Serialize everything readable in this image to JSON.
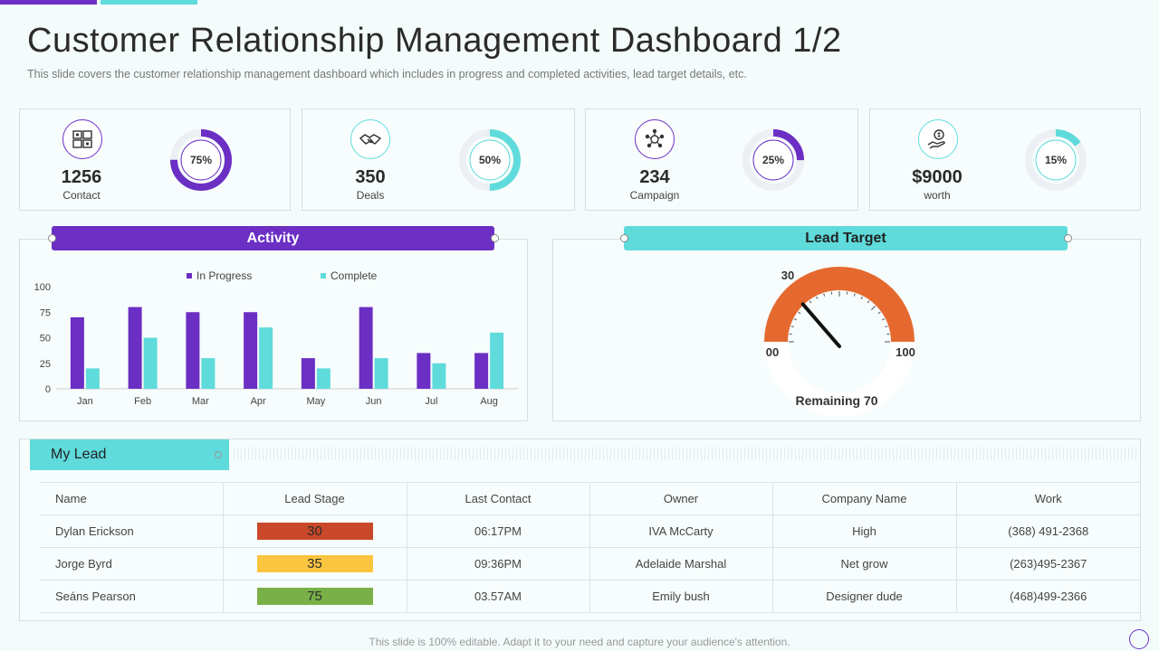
{
  "header": {
    "title": "Customer Relationship Management Dashboard 1/2",
    "subtitle": "This slide covers the customer relationship management dashboard which includes in progress and completed activities, lead target details, etc."
  },
  "colors": {
    "purple": "#6b2fc4",
    "teal": "#5fdbdb",
    "orange": "#e5692e",
    "red": "#c9482a",
    "yellow": "#fbc540",
    "green": "#79b148"
  },
  "kpis": [
    {
      "icon": "contact-card-icon",
      "value": "1256",
      "label": "Contact",
      "percent_label": "75%",
      "percent": 75,
      "color": "#6b2fc4"
    },
    {
      "icon": "handshake-icon",
      "value": "350",
      "label": "Deals",
      "percent_label": "50%",
      "percent": 50,
      "color": "#5fdbdb"
    },
    {
      "icon": "campaign-network-icon",
      "value": "234",
      "label": "Campaign",
      "percent_label": "25%",
      "percent": 25,
      "color": "#6b2fc4"
    },
    {
      "icon": "money-hand-icon",
      "value": "$9000",
      "label": "worth",
      "percent_label": "15%",
      "percent": 15,
      "color": "#5fdbdb"
    }
  ],
  "activity": {
    "title": "Activity",
    "legend": {
      "in_progress": "In Progress",
      "complete": "Complete"
    }
  },
  "chart_data": {
    "type": "bar",
    "categories": [
      "Jan",
      "Feb",
      "Mar",
      "Apr",
      "May",
      "Jun",
      "Jul",
      "Aug"
    ],
    "series": [
      {
        "name": "In Progress",
        "values": [
          70,
          80,
          75,
          75,
          30,
          80,
          35,
          35
        ],
        "color": "#6b2fc4"
      },
      {
        "name": "Complete",
        "values": [
          20,
          50,
          30,
          60,
          20,
          30,
          25,
          55
        ],
        "color": "#5fdbdb"
      }
    ],
    "yticks": [
      "0",
      "25",
      "50",
      "75",
      "100"
    ],
    "ylim": [
      0,
      100
    ],
    "grid": false,
    "legend_position": "top"
  },
  "lead_target": {
    "title": "Lead Target",
    "value": 30,
    "value_label": "30",
    "min_label": "00",
    "max_label": "100",
    "remaining_label": "Remaining 70"
  },
  "my_lead": {
    "tab_label": "My Lead",
    "columns": [
      "Name",
      "Lead Stage",
      "Last Contact",
      "Owner",
      "Company Name",
      "Work"
    ],
    "rows": [
      {
        "name": "Dylan Erickson",
        "stage": "30",
        "stage_color": "#c9482a",
        "last_contact": "06:17PM",
        "owner": "IVA McCarty",
        "company": "High",
        "work": "(368) 491-2368"
      },
      {
        "name": "Jorge Byrd",
        "stage": "35",
        "stage_color": "#fbc540",
        "last_contact": "09:36PM",
        "owner": "Adelaide Marshal",
        "company": "Net grow",
        "work": "(263)495-2367"
      },
      {
        "name": "Seáns Pearson",
        "stage": "75",
        "stage_color": "#79b148",
        "last_contact": "03.57AM",
        "owner": "Emily bush",
        "company": "Designer dude",
        "work": "(468)499-2366"
      }
    ]
  },
  "footer": "This slide is 100% editable. Adapt it to your need and capture your audience's attention."
}
